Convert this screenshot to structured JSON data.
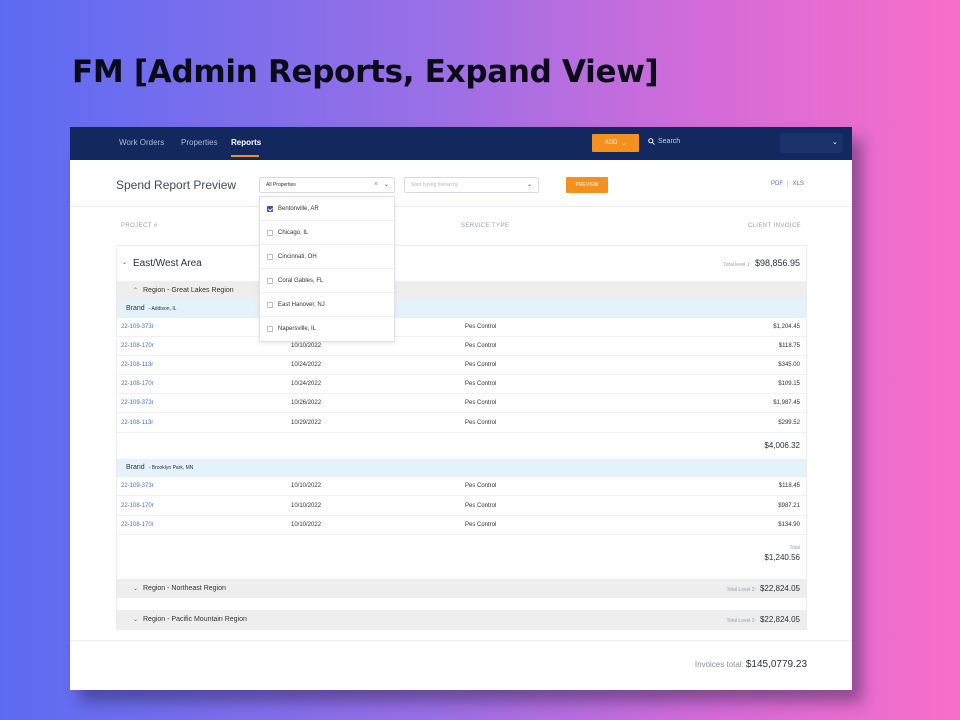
{
  "slide": {
    "title": "FM [Admin Reports, Expand View]"
  },
  "nav": {
    "links": [
      "Work Orders",
      "Properties",
      "Reports"
    ],
    "add_label": "ADD",
    "search_placeholder": "Search",
    "accent": "#f4901e",
    "bg": "#13285e"
  },
  "header": {
    "title": "Spend Report Preview",
    "property_select": "All Properties",
    "hierarchy_placeholder": "Start typing hierarchy",
    "preview_label": "PREVIEW",
    "pdf": "PDF",
    "xls": "XLS"
  },
  "columns": {
    "project": "PROJECT #",
    "service": "SERVICE TYPE",
    "invoice": "CLIENT INVOICE"
  },
  "area": {
    "title": "East/West Area",
    "total_label": "Total level 1:",
    "total": "$98,856.95"
  },
  "region1": {
    "title": "Region - Great Lakes Region"
  },
  "brand1": {
    "label": "Brand",
    "location": "- Addison, IL",
    "rows": [
      {
        "project": "22-109-373r",
        "date": "",
        "service": "Pes Control",
        "amount": "$1,204.45"
      },
      {
        "project": "22-108-170r",
        "date": "10/10/2022",
        "service": "Pes Control",
        "amount": "$118.75"
      },
      {
        "project": "22-108-113r",
        "date": "10/24/2022",
        "service": "Pes Control",
        "amount": "$345.00"
      },
      {
        "project": "22-108-170r",
        "date": "10/24/2022",
        "service": "Pes Control",
        "amount": "$109.15"
      },
      {
        "project": "22-109-373r",
        "date": "10/26/2022",
        "service": "Pes Control",
        "amount": "$1,987.45"
      },
      {
        "project": "22-108-113r",
        "date": "10/29/2022",
        "service": "Pes Control",
        "amount": "$299.52"
      }
    ],
    "subtotal": "$4,006.32"
  },
  "brand2": {
    "label": "Brand",
    "location": "- Brooklyn Park, MN",
    "rows": [
      {
        "project": "22-109-373r",
        "date": "10/10/2022",
        "service": "Pes Control",
        "amount": "$118.45"
      },
      {
        "project": "22-108-170r",
        "date": "10/10/2022",
        "service": "Pes Control",
        "amount": "$987.21"
      },
      {
        "project": "22-108-170r",
        "date": "10/10/2022",
        "service": "Pes Control",
        "amount": "$134.90"
      }
    ],
    "total_label": "Total",
    "subtotal": "$1,240.56"
  },
  "region2": {
    "title": "Region - Northeast Region",
    "total_label": "Total Level 2:",
    "total": "$22,824.05"
  },
  "region3": {
    "title": "Region - Pacific Mountain Region",
    "total_label": "Total Level 2:",
    "total": "$22,824.05"
  },
  "footer": {
    "label": "Invoices total:",
    "total": "$145,0779.23"
  },
  "dropdown": {
    "options": [
      {
        "label": "Bentonville, AR",
        "checked": true
      },
      {
        "label": "Chicago, IL",
        "checked": false
      },
      {
        "label": "Cincinnati, OH",
        "checked": false
      },
      {
        "label": "Coral Gables, FL",
        "checked": false
      },
      {
        "label": "East Hanover, NJ",
        "checked": false
      },
      {
        "label": "Napersville, IL",
        "checked": false
      }
    ]
  }
}
